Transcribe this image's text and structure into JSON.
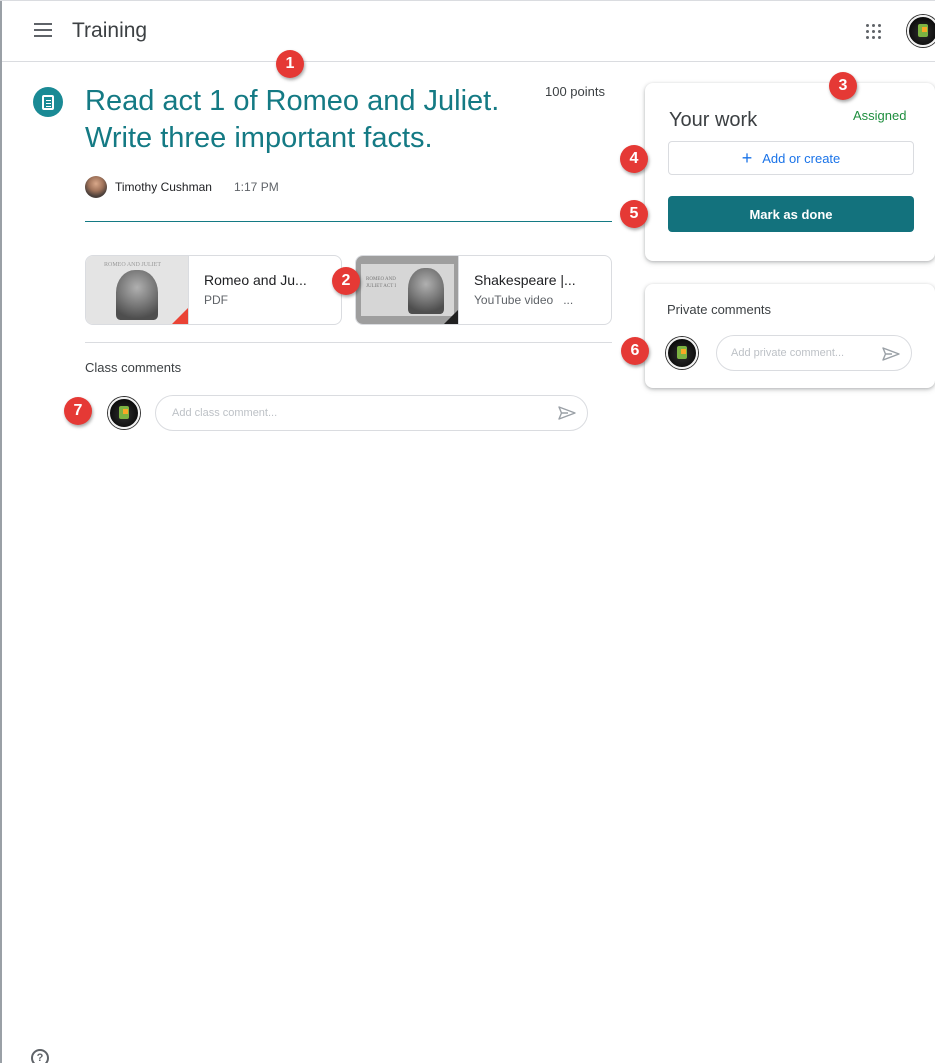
{
  "header": {
    "class_name": "Training",
    "menu_icon": "menu-icon",
    "apps_icon": "apps-grid-icon",
    "account_icon": "account-avatar-icon"
  },
  "assignment": {
    "title": "Read act 1 of Romeo and Juliet. Write three important facts.",
    "points": "100 points",
    "teacher": "Timothy Cushman",
    "time": "1:17 PM",
    "icon": "assignment-icon",
    "accent_color": "#147a84"
  },
  "attachments": [
    {
      "title": "Romeo and Ju...",
      "type": "PDF",
      "icon": "pdf-icon"
    },
    {
      "title": "Shakespeare |...",
      "type": "YouTube video",
      "suffix": "...",
      "icon": "youtube-icon"
    }
  ],
  "class_comments": {
    "label": "Class comments",
    "placeholder": "Add class comment..."
  },
  "your_work": {
    "title": "Your work",
    "status": "Assigned",
    "status_color": "#1e8e3e",
    "add_label": "Add or create",
    "done_label": "Mark as done",
    "done_color": "#13727d"
  },
  "private_comments": {
    "label": "Private comments",
    "placeholder": "Add private comment..."
  },
  "callouts": [
    "1",
    "2",
    "3",
    "4",
    "5",
    "6",
    "7"
  ],
  "callout_color": "#e53935",
  "help": {
    "glyph": "?"
  }
}
